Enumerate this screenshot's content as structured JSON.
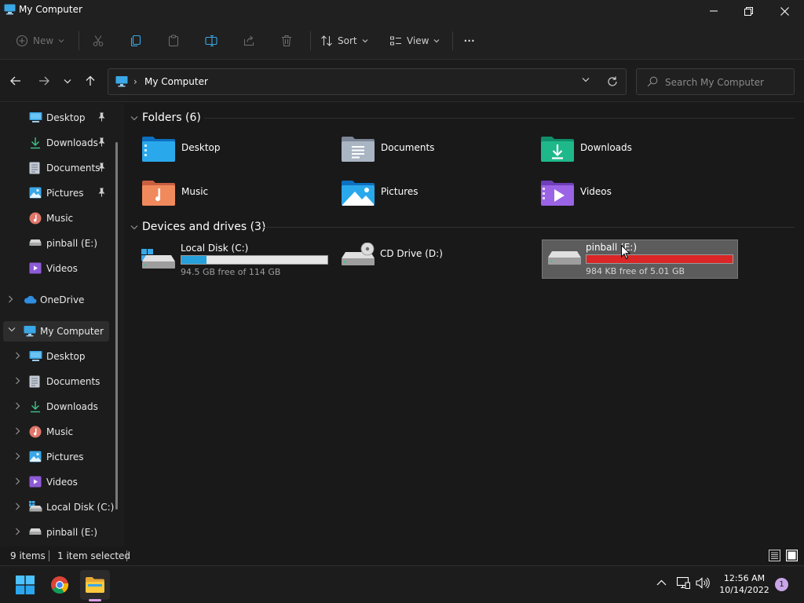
{
  "window": {
    "title": "My Computer"
  },
  "toolbar": {
    "new_label": "New",
    "sort_label": "Sort",
    "view_label": "View",
    "more_label": "···"
  },
  "address": {
    "path": "My Computer",
    "separator": "›"
  },
  "search": {
    "placeholder": "Search My Computer"
  },
  "sidebar": {
    "quick_access": [
      {
        "label": "Desktop",
        "icon": "desktop-icon",
        "pinned": true
      },
      {
        "label": "Downloads",
        "icon": "download-icon",
        "pinned": true
      },
      {
        "label": "Documents",
        "icon": "document-icon",
        "pinned": true
      },
      {
        "label": "Pictures",
        "icon": "pictures-icon",
        "pinned": true
      },
      {
        "label": "Music",
        "icon": "music-icon",
        "pinned": false
      },
      {
        "label": "pinball (E:)",
        "icon": "drive-icon",
        "pinned": false
      },
      {
        "label": "Videos",
        "icon": "video-icon",
        "pinned": false
      }
    ],
    "onedrive": "OneDrive",
    "this_pc": "My Computer",
    "this_pc_children": [
      {
        "label": "Desktop",
        "icon": "desktop-icon"
      },
      {
        "label": "Documents",
        "icon": "document-icon"
      },
      {
        "label": "Downloads",
        "icon": "download-icon"
      },
      {
        "label": "Music",
        "icon": "music-icon"
      },
      {
        "label": "Pictures",
        "icon": "pictures-icon"
      },
      {
        "label": "Videos",
        "icon": "video-icon"
      },
      {
        "label": "Local Disk (C:)",
        "icon": "local-disk-icon"
      },
      {
        "label": "pinball (E:)",
        "icon": "drive-icon"
      }
    ]
  },
  "main": {
    "folders_header": "Folders (6)",
    "folders": [
      {
        "label": "Desktop",
        "icon": "desktop-folder-icon"
      },
      {
        "label": "Documents",
        "icon": "documents-folder-icon"
      },
      {
        "label": "Downloads",
        "icon": "downloads-folder-icon"
      },
      {
        "label": "Music",
        "icon": "music-folder-icon"
      },
      {
        "label": "Pictures",
        "icon": "pictures-folder-icon"
      },
      {
        "label": "Videos",
        "icon": "videos-folder-icon"
      }
    ],
    "drives_header": "Devices and drives (3)",
    "drives": [
      {
        "label": "Local Disk (C:)",
        "free_text": "94.5 GB free of 114 GB",
        "used_fraction": 0.17,
        "bar_color": "#26a0da",
        "selected": false,
        "has_bar": true
      },
      {
        "label": "CD Drive (D:)",
        "free_text": "",
        "selected": false,
        "has_bar": false
      },
      {
        "label": "pinball (E:)",
        "free_text": "984 KB free of 5.01 GB",
        "used_fraction": 1.0,
        "bar_color": "#da2626",
        "selected": true,
        "has_bar": true
      }
    ]
  },
  "status": {
    "items": "9 items",
    "selected": "1 item selected"
  },
  "taskbar": {
    "time": "12:56 AM",
    "date": "10/14/2022",
    "notifications": "1"
  },
  "colors": {
    "accent": "#26a0da",
    "drive_full": "#da2626",
    "selection": "#5c5c5c"
  }
}
